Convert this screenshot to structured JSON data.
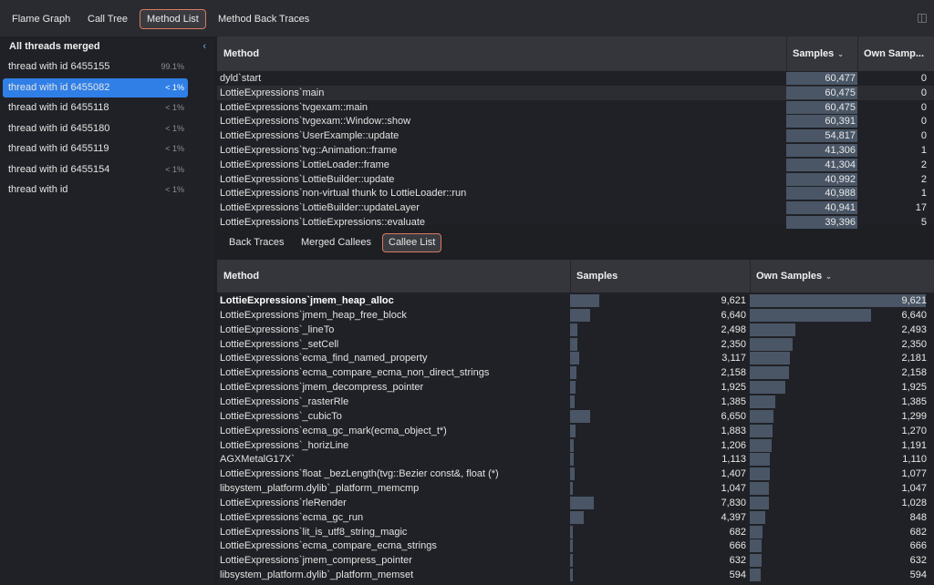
{
  "tabs": [
    "Flame Graph",
    "Call Tree",
    "Method List",
    "Method Back Traces"
  ],
  "active_tab": 2,
  "sidebar": {
    "header": "All threads merged",
    "threads": [
      {
        "name": "thread with id 6455155",
        "pct": "99.1%"
      },
      {
        "name": "thread with id 6455082",
        "pct": "< 1%"
      },
      {
        "name": "thread with id 6455118",
        "pct": "< 1%"
      },
      {
        "name": "thread with id 6455180",
        "pct": "< 1%"
      },
      {
        "name": "thread with id 6455119",
        "pct": "< 1%"
      },
      {
        "name": "thread with id 6455154",
        "pct": "< 1%"
      },
      {
        "name": "thread with id",
        "pct": "< 1%"
      }
    ],
    "selected": 1
  },
  "top_table": {
    "headers": {
      "method": "Method",
      "samples": "Samples",
      "own": "Own Samp..."
    },
    "rows": [
      {
        "method": "dyld`start",
        "samples": "60,477",
        "own": "0"
      },
      {
        "method": "LottieExpressions`main",
        "samples": "60,475",
        "own": "0"
      },
      {
        "method": "LottieExpressions`tvgexam::main",
        "samples": "60,475",
        "own": "0"
      },
      {
        "method": "LottieExpressions`tvgexam::Window::show",
        "samples": "60,391",
        "own": "0"
      },
      {
        "method": "LottieExpressions`UserExample::update",
        "samples": "54,817",
        "own": "0"
      },
      {
        "method": "LottieExpressions`tvg::Animation::frame",
        "samples": "41,306",
        "own": "1"
      },
      {
        "method": "LottieExpressions`LottieLoader::frame",
        "samples": "41,304",
        "own": "2"
      },
      {
        "method": "LottieExpressions`LottieBuilder::update",
        "samples": "40,992",
        "own": "2"
      },
      {
        "method": "LottieExpressions`non-virtual thunk to LottieLoader::run",
        "samples": "40,988",
        "own": "1"
      },
      {
        "method": "LottieExpressions`LottieBuilder::updateLayer",
        "samples": "40,941",
        "own": "17"
      },
      {
        "method": "LottieExpressions`LottieExpressions::evaluate",
        "samples": "39,396",
        "own": "5"
      }
    ]
  },
  "sub_tabs": [
    "Back Traces",
    "Merged Callees",
    "Callee List"
  ],
  "active_sub_tab": 2,
  "bottom_table": {
    "headers": {
      "method": "Method",
      "samples": "Samples",
      "own": "Own Samples"
    },
    "rows": [
      {
        "method": "LottieExpressions`jmem_heap_alloc",
        "samples": "9,621",
        "own": "9,621",
        "s": 9621,
        "o": 9621
      },
      {
        "method": "LottieExpressions`jmem_heap_free_block",
        "samples": "6,640",
        "own": "6,640",
        "s": 6640,
        "o": 6640
      },
      {
        "method": "LottieExpressions`_lineTo",
        "samples": "2,498",
        "own": "2,493",
        "s": 2498,
        "o": 2493
      },
      {
        "method": "LottieExpressions`_setCell",
        "samples": "2,350",
        "own": "2,350",
        "s": 2350,
        "o": 2350
      },
      {
        "method": "LottieExpressions`ecma_find_named_property",
        "samples": "3,117",
        "own": "2,181",
        "s": 3117,
        "o": 2181
      },
      {
        "method": "LottieExpressions`ecma_compare_ecma_non_direct_strings",
        "samples": "2,158",
        "own": "2,158",
        "s": 2158,
        "o": 2158
      },
      {
        "method": "LottieExpressions`jmem_decompress_pointer",
        "samples": "1,925",
        "own": "1,925",
        "s": 1925,
        "o": 1925
      },
      {
        "method": "LottieExpressions`_rasterRle",
        "samples": "1,385",
        "own": "1,385",
        "s": 1385,
        "o": 1385
      },
      {
        "method": "LottieExpressions`_cubicTo",
        "samples": "6,650",
        "own": "1,299",
        "s": 6650,
        "o": 1299
      },
      {
        "method": "LottieExpressions`ecma_gc_mark(ecma_object_t*)",
        "samples": "1,883",
        "own": "1,270",
        "s": 1883,
        "o": 1270
      },
      {
        "method": "LottieExpressions`_horizLine",
        "samples": "1,206",
        "own": "1,191",
        "s": 1206,
        "o": 1191
      },
      {
        "method": "AGXMetalG17X`",
        "samples": "1,113",
        "own": "1,110",
        "s": 1113,
        "o": 1110
      },
      {
        "method": "LottieExpressions`float _bezLength(tvg::Bezier const&, float (*)",
        "samples": "1,407",
        "own": "1,077",
        "s": 1407,
        "o": 1077
      },
      {
        "method": "libsystem_platform.dylib`_platform_memcmp",
        "samples": "1,047",
        "own": "1,047",
        "s": 1047,
        "o": 1047
      },
      {
        "method": "LottieExpressions`rleRender",
        "samples": "7,830",
        "own": "1,028",
        "s": 7830,
        "o": 1028
      },
      {
        "method": "LottieExpressions`ecma_gc_run",
        "samples": "4,397",
        "own": "848",
        "s": 4397,
        "o": 848
      },
      {
        "method": "LottieExpressions`lit_is_utf8_string_magic",
        "samples": "682",
        "own": "682",
        "s": 682,
        "o": 682
      },
      {
        "method": "LottieExpressions`ecma_compare_ecma_strings",
        "samples": "666",
        "own": "666",
        "s": 666,
        "o": 666
      },
      {
        "method": "LottieExpressions`jmem_compress_pointer",
        "samples": "632",
        "own": "632",
        "s": 632,
        "o": 632
      },
      {
        "method": "libsystem_platform.dylib`_platform_memset",
        "samples": "594",
        "own": "594",
        "s": 594,
        "o": 594
      }
    ]
  }
}
